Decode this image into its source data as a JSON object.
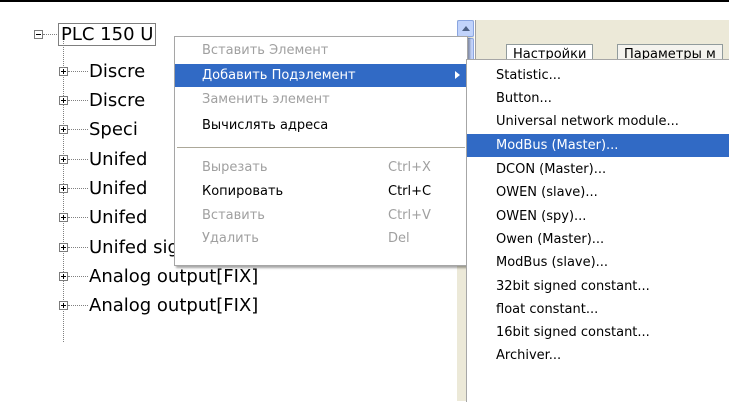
{
  "tree": {
    "root": {
      "label": "PLC 150 U"
    },
    "children": [
      {
        "label": "Discre"
      },
      {
        "label": "Discre"
      },
      {
        "label": "Speci"
      },
      {
        "label": "Unifed"
      },
      {
        "label": "Unifed"
      },
      {
        "label": "Unifed"
      },
      {
        "label": "Unifed signal sensor[SLOT]"
      },
      {
        "label": "Analog output[FIX]"
      },
      {
        "label": "Analog output[FIX]"
      }
    ]
  },
  "tabs": [
    {
      "label": "Настройки"
    },
    {
      "label": "Параметры м"
    }
  ],
  "context_menu": {
    "items": [
      {
        "label": "Вставить Элемент",
        "shortcut": "",
        "disabled": true
      },
      {
        "label": "Добавить Подэлемент",
        "shortcut": "",
        "disabled": false,
        "highlighted": true,
        "has_submenu": true
      },
      {
        "label": "Заменить элемент",
        "shortcut": "",
        "disabled": true
      },
      {
        "label": "Вычислять адреса",
        "shortcut": "",
        "disabled": false
      },
      {
        "label": "Вырезать",
        "shortcut": "Ctrl+X",
        "disabled": true
      },
      {
        "label": "Копировать",
        "shortcut": "Ctrl+C",
        "disabled": false
      },
      {
        "label": "Вставить",
        "shortcut": "Ctrl+V",
        "disabled": true
      },
      {
        "label": "Удалить",
        "shortcut": "Del",
        "disabled": true
      }
    ]
  },
  "submenu": {
    "items": [
      {
        "label": "Statistic..."
      },
      {
        "label": "Button..."
      },
      {
        "label": "Universal network module..."
      },
      {
        "label": "ModBus (Master)...",
        "highlighted": true
      },
      {
        "label": "DCON (Master)..."
      },
      {
        "label": "OWEN (slave)..."
      },
      {
        "label": "OWEN (spy)..."
      },
      {
        "label": "Owen (Master)..."
      },
      {
        "label": "ModBus (slave)..."
      },
      {
        "label": "32bit signed constant..."
      },
      {
        "label": "float constant..."
      },
      {
        "label": "16bit signed constant..."
      },
      {
        "label": "Archiver..."
      }
    ]
  },
  "colors": {
    "highlight": "#316ac5",
    "disabled_text": "#a0a0a0",
    "panel": "#ece9d8"
  }
}
